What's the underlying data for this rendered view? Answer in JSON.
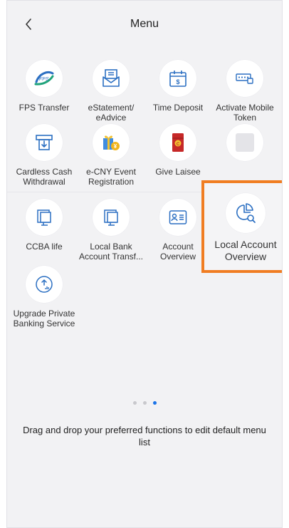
{
  "header": {
    "title": "Menu",
    "back_icon": "chevron-left-icon"
  },
  "items": [
    {
      "label": "FPS Transfer",
      "icon": "fps-icon"
    },
    {
      "label": "eStatement/\neAdvice",
      "icon": "estatement-icon"
    },
    {
      "label": "Time Deposit",
      "icon": "time-deposit-icon"
    },
    {
      "label": "Activate Mobile\nToken",
      "icon": "mobile-token-icon"
    },
    {
      "label": "Cardless Cash\nWithdrawal",
      "icon": "cardless-cash-icon"
    },
    {
      "label": "e-CNY Event\nRegistration",
      "icon": "ecny-gift-icon"
    },
    {
      "label": "Give Laisee",
      "icon": "laisee-envelope-icon"
    },
    {
      "label": "",
      "icon": "placeholder-icon"
    },
    {
      "label": "CCBA life",
      "icon": "ccba-life-icon"
    },
    {
      "label": "Local Bank\nAccount Transf...",
      "icon": "local-bank-transfer-icon"
    },
    {
      "label": "Account\nOverview",
      "icon": "account-overview-icon"
    },
    {
      "label": "Local Account\nOverview",
      "icon": "local-account-overview-icon"
    },
    {
      "label": "Upgrade Private\nBanking Service",
      "icon": "upgrade-private-banking-icon"
    }
  ],
  "pagination": {
    "count": 3,
    "active_index": 2
  },
  "hint": "Drag and drop your preferred functions to edit default menu list",
  "colors": {
    "accent": "#1a73e8",
    "highlight": "#f07d22",
    "icon_blue": "#2b6fc2",
    "background": "#f2f2f4"
  }
}
